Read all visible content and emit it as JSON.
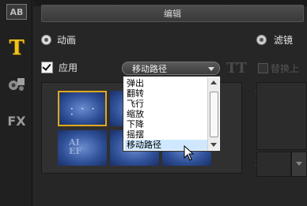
{
  "sidebar": {
    "ab_label": "AB",
    "fx_label": "FX"
  },
  "header": {
    "title": "编辑"
  },
  "options": {
    "animation_label": "动画",
    "filter_label": "滤镜",
    "apply_label": "应用",
    "replace_label": "替换上",
    "animation_selected": true,
    "apply_checked": true
  },
  "dropdown": {
    "selected": "移动路径",
    "items": [
      "弹出",
      "翻转",
      "飞行",
      "缩放",
      "下降",
      "摇摆",
      "移动路径"
    ],
    "highlighted_index": 6
  },
  "thumbnails": {
    "sample_letters": [
      "AI",
      "EF"
    ]
  },
  "colors": {
    "accent": "#e0a91b",
    "highlight": "#cfe8ff",
    "t_icon": "#f2c21b"
  }
}
